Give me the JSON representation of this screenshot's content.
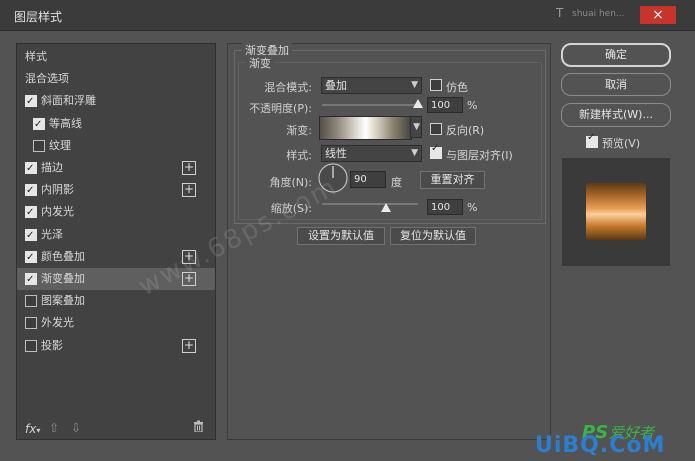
{
  "window": {
    "title": "图层样式",
    "close_symbol": "×",
    "bg_ps_label": "T",
    "bg_tab_text": "shuai hen..."
  },
  "left_panel": {
    "items": [
      {
        "label": "样式",
        "checkbox": false,
        "checked": false,
        "indent": false,
        "plus": false,
        "selected": false
      },
      {
        "label": "混合选项",
        "checkbox": false,
        "checked": false,
        "indent": false,
        "plus": false,
        "selected": false
      },
      {
        "label": "斜面和浮雕",
        "checkbox": true,
        "checked": true,
        "indent": false,
        "plus": false,
        "selected": false
      },
      {
        "label": "等高线",
        "checkbox": true,
        "checked": true,
        "indent": true,
        "plus": false,
        "selected": false
      },
      {
        "label": "纹理",
        "checkbox": true,
        "checked": false,
        "indent": true,
        "plus": false,
        "selected": false
      },
      {
        "label": "描边",
        "checkbox": true,
        "checked": true,
        "indent": false,
        "plus": true,
        "selected": false
      },
      {
        "label": "内阴影",
        "checkbox": true,
        "checked": true,
        "indent": false,
        "plus": true,
        "selected": false
      },
      {
        "label": "内发光",
        "checkbox": true,
        "checked": true,
        "indent": false,
        "plus": false,
        "selected": false
      },
      {
        "label": "光泽",
        "checkbox": true,
        "checked": true,
        "indent": false,
        "plus": false,
        "selected": false
      },
      {
        "label": "颜色叠加",
        "checkbox": true,
        "checked": true,
        "indent": false,
        "plus": true,
        "selected": false
      },
      {
        "label": "渐变叠加",
        "checkbox": true,
        "checked": true,
        "indent": false,
        "plus": true,
        "selected": true
      },
      {
        "label": "图案叠加",
        "checkbox": true,
        "checked": false,
        "indent": false,
        "plus": false,
        "selected": false
      },
      {
        "label": "外发光",
        "checkbox": true,
        "checked": false,
        "indent": false,
        "plus": false,
        "selected": false
      },
      {
        "label": "投影",
        "checkbox": true,
        "checked": false,
        "indent": false,
        "plus": true,
        "selected": false
      }
    ],
    "plus_symbol": "+",
    "fx_label": "fx",
    "up_arrow": "⇧",
    "down_arrow": "⇩",
    "trash": "🗑"
  },
  "gradient_overlay": {
    "section_title": "渐变叠加",
    "subsection_title": "渐变",
    "blend_mode_label": "混合模式:",
    "blend_mode_value": "叠加",
    "dither_label": "仿色",
    "dither_checked": false,
    "opacity_label": "不透明度(P):",
    "opacity_value": "100",
    "opacity_level": 1.0,
    "percent": "%",
    "gradient_label": "渐变:",
    "reverse_label": "反向(R)",
    "reverse_checked": false,
    "style_label": "样式:",
    "style_value": "线性",
    "align_label": "与图层对齐(I)",
    "align_checked": true,
    "angle_label": "角度(N):",
    "angle_value": "90",
    "angle_unit": "度",
    "reset_align_button": "重置对齐",
    "scale_label": "缩放(S):",
    "scale_value": "100",
    "scale_level": 0.67,
    "make_default_button": "设置为默认值",
    "reset_default_button": "复位为默认值"
  },
  "right_panel": {
    "ok_button": "确定",
    "cancel_button": "取消",
    "new_style_button": "新建样式(W)...",
    "preview_label": "预览(V)",
    "preview_checked": true
  },
  "watermarks": {
    "diagonal": "www.68ps.com",
    "brand_ps": "PS",
    "brand_cn": "爱好者",
    "brand_url": "UiBQ.CoM"
  },
  "colors": {
    "accent_close": "#c7342c",
    "dialog_bg": "#535353",
    "panel_bg": "#424242",
    "brand_green": "#3bb34a",
    "brand_blue": "#2a7fd1"
  }
}
